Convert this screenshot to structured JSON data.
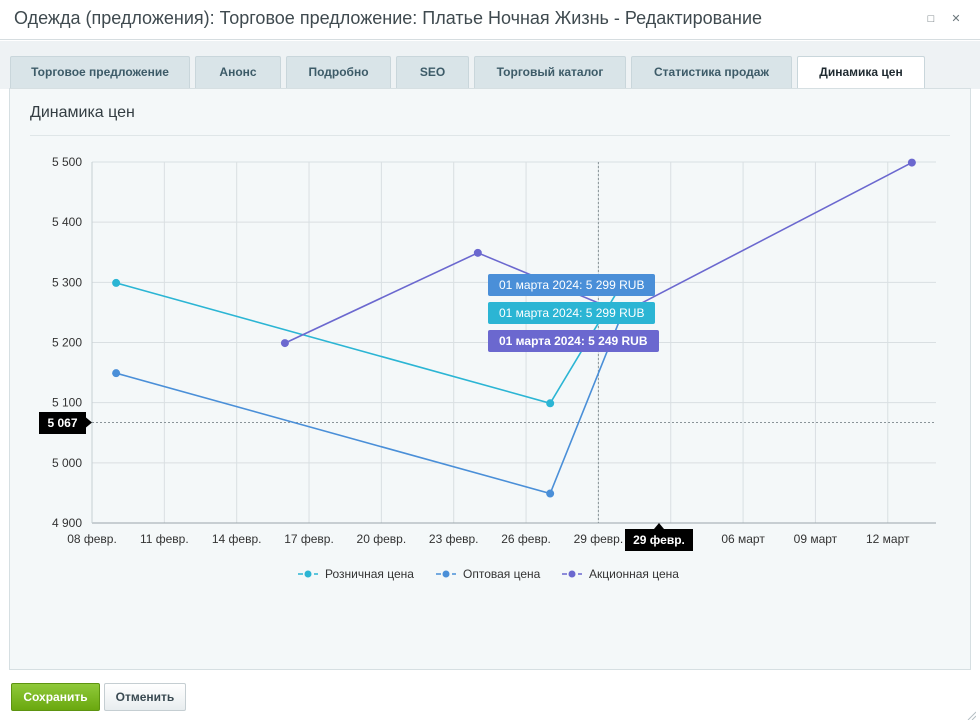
{
  "window": {
    "title": "Одежда (предложения): Торговое предложение: Платье Ночная Жизнь - Редактирование",
    "maximize_icon": "maximize-icon",
    "close_icon": "close-icon"
  },
  "tabs": [
    {
      "label": "Торговое предложение",
      "active": false
    },
    {
      "label": "Анонс",
      "active": false
    },
    {
      "label": "Подробно",
      "active": false
    },
    {
      "label": "SEO",
      "active": false
    },
    {
      "label": "Торговый каталог",
      "active": false
    },
    {
      "label": "Статистика продаж",
      "active": false
    },
    {
      "label": "Динамика цен",
      "active": true
    }
  ],
  "panel": {
    "title": "Динамика цен"
  },
  "chart_data": {
    "type": "line",
    "title": "",
    "xlabel": "",
    "ylabel": "",
    "ylim": [
      4900,
      5500
    ],
    "y_ticks": [
      4900,
      5000,
      5100,
      5200,
      5300,
      5400,
      5500
    ],
    "y_tick_labels": [
      "4 900",
      "5 000",
      "5 100",
      "5 200",
      "5 300",
      "5 400",
      "5 500"
    ],
    "x_range": [
      "2024-02-08",
      "2024-03-14"
    ],
    "x_ticks": [
      "2024-02-08",
      "2024-02-11",
      "2024-02-14",
      "2024-02-17",
      "2024-02-20",
      "2024-02-23",
      "2024-02-26",
      "2024-02-29",
      "2024-03-03",
      "2024-03-06",
      "2024-03-09",
      "2024-03-12"
    ],
    "x_tick_labels": [
      "08 февр.",
      "11 февр.",
      "14 февр.",
      "17 февр.",
      "20 февр.",
      "23 февр.",
      "26 февр.",
      "29 февр.",
      "",
      "06 март",
      "09 март",
      "12 март"
    ],
    "grid": true,
    "legend_position": "bottom",
    "series": [
      {
        "name": "Розничная цена",
        "color": "#2bb5d4",
        "x": [
          "2024-02-09",
          "2024-02-27",
          "2024-03-01"
        ],
        "y": [
          5299,
          5099,
          5299
        ]
      },
      {
        "name": "Оптовая цена",
        "color": "#4a8fd8",
        "x": [
          "2024-02-09",
          "2024-02-27",
          "2024-03-01"
        ],
        "y": [
          5149,
          4949,
          5249
        ]
      },
      {
        "name": "Акционная цена",
        "color": "#6b68cf",
        "x": [
          "2024-02-16",
          "2024-02-24",
          "2024-03-01",
          "2024-03-13"
        ],
        "y": [
          5199,
          5349,
          5249,
          5499
        ]
      }
    ],
    "cursor": {
      "x": "2024-02-29",
      "y": 5067,
      "x_label": "29 февр.",
      "y_label": "5 067"
    },
    "tooltips": [
      {
        "text": "01 марта 2024: 5 299 RUB",
        "color": "#4a8fd8",
        "bold": false
      },
      {
        "text": "01 марта 2024: 5 299 RUB",
        "color": "#2bb5d4",
        "bold": false
      },
      {
        "text": "01 марта 2024: 5 249 RUB",
        "color": "#6b68cf",
        "bold": true
      }
    ]
  },
  "footer": {
    "save_label": "Сохранить",
    "cancel_label": "Отменить"
  }
}
